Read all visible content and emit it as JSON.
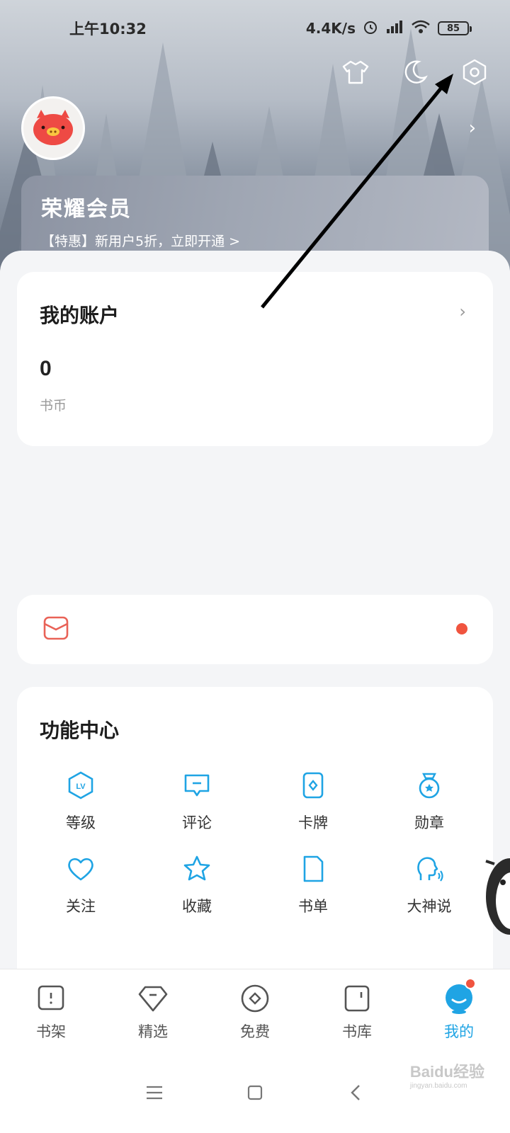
{
  "status_bar": {
    "time": "上午10:32",
    "net_speed": "4.4K/s",
    "battery": "85"
  },
  "header": {
    "icons": [
      "shirt-icon",
      "moon-icon",
      "settings-icon"
    ],
    "vip": {
      "title": "荣耀会员",
      "subtitle": "【特惠】新用户5折，立即开通 >"
    }
  },
  "account": {
    "title": "我的账户",
    "coins": "0",
    "coin_label": "书币"
  },
  "function_center": {
    "title": "功能中心",
    "items": [
      {
        "label": "等级",
        "icon": "level-icon"
      },
      {
        "label": "评论",
        "icon": "comment-icon"
      },
      {
        "label": "卡牌",
        "icon": "card-icon"
      },
      {
        "label": "勋章",
        "icon": "medal-icon"
      },
      {
        "label": "关注",
        "icon": "heart-icon"
      },
      {
        "label": "收藏",
        "icon": "star-icon"
      },
      {
        "label": "书单",
        "icon": "booklist-icon"
      },
      {
        "label": "大神说",
        "icon": "talk-icon"
      }
    ]
  },
  "bottom_nav": [
    {
      "label": "书架",
      "icon": "bookshelf-icon"
    },
    {
      "label": "精选",
      "icon": "featured-icon"
    },
    {
      "label": "免费",
      "icon": "free-icon"
    },
    {
      "label": "书库",
      "icon": "library-icon"
    },
    {
      "label": "我的",
      "icon": "me-icon",
      "active": true
    }
  ],
  "watermark": {
    "brand": "Baidu经验",
    "url": "jingyan.baidu.com"
  },
  "colors": {
    "accent": "#1fa4e4",
    "badge": "#f0543f",
    "annotation_arrow": "#000000"
  }
}
